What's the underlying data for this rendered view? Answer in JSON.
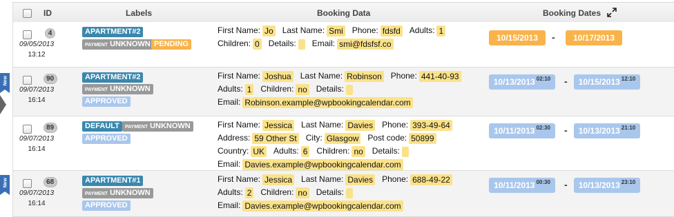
{
  "header": {
    "id": "ID",
    "labels": "Labels",
    "booking_data": "Booking Data",
    "booking_dates": "Booking Dates"
  },
  "new_flag": "New",
  "rows": [
    {
      "id": "4",
      "date": "09/05/2013",
      "time": "13:12",
      "resource": "APARTMENT#2",
      "payment_small": "PAYMENT",
      "payment": "UNKNOWN",
      "status": "PENDING",
      "lines": [
        [
          [
            "First Name:",
            "Jo"
          ],
          [
            "Last Name:",
            "Smi"
          ],
          [
            "Phone:",
            "fdsfd"
          ],
          [
            "Adults:",
            "1"
          ]
        ],
        [
          [
            "Children:",
            "0"
          ],
          [
            "Details:",
            ""
          ],
          [
            "Email:",
            "smi@fdsfsf.co"
          ]
        ]
      ],
      "dates": [
        {
          "d": "10/15/2013",
          "t": ""
        },
        {
          "d": "10/17/2013",
          "t": ""
        }
      ],
      "dash": "-"
    },
    {
      "id": "90",
      "date": "09/07/2013",
      "time": "16:14",
      "resource": "APARTMENT#2",
      "payment_small": "PAYMENT",
      "payment": "UNKNOWN",
      "status": "APPROVED",
      "lines": [
        [
          [
            "First Name:",
            "Joshua"
          ],
          [
            "Last Name:",
            "Robinson"
          ],
          [
            "Phone:",
            "441-40-93"
          ]
        ],
        [
          [
            "Adults:",
            "1"
          ],
          [
            "Children:",
            "no"
          ],
          [
            "Details:",
            ""
          ]
        ],
        [
          [
            "Email:",
            "Robinson.example@wpbookingcalendar.com"
          ]
        ]
      ],
      "dates": [
        {
          "d": "10/13/2013",
          "t": "02:10"
        },
        {
          "d": "10/15/2013",
          "t": "12:10"
        }
      ],
      "dash": "-"
    },
    {
      "id": "89",
      "date": "09/07/2013",
      "time": "16:14",
      "resource": "DEFAULT",
      "payment_small": "PAYMENT",
      "payment": "UNKNOWN",
      "status": "APPROVED",
      "lines": [
        [
          [
            "First Name:",
            "Jessica"
          ],
          [
            "Last Name:",
            "Davies"
          ],
          [
            "Phone:",
            "393-49-64"
          ]
        ],
        [
          [
            "Address:",
            "59 Other St"
          ],
          [
            "City:",
            "Glasgow"
          ],
          [
            "Post code:",
            "50899"
          ]
        ],
        [
          [
            "Country:",
            "UK"
          ],
          [
            "Adults:",
            "6"
          ],
          [
            "Children:",
            "no"
          ],
          [
            "Details:",
            ""
          ]
        ],
        [
          [
            "Email:",
            "Davies.example@wpbookingcalendar.com"
          ]
        ]
      ],
      "dates": [
        {
          "d": "10/11/2013",
          "t": "02:30"
        },
        {
          "d": "10/13/2013",
          "t": "21:10"
        }
      ],
      "dash": "-"
    },
    {
      "id": "68",
      "date": "09/07/2013",
      "time": "16:14",
      "resource": "APARTMENT#1",
      "payment_small": "PAYMENT",
      "payment": "UNKNOWN",
      "status": "APPROVED",
      "lines": [
        [
          [
            "First Name:",
            "Jessica"
          ],
          [
            "Last Name:",
            "Davies"
          ],
          [
            "Phone:",
            "688-49-22"
          ]
        ],
        [
          [
            "Adults:",
            "2"
          ],
          [
            "Children:",
            "no"
          ],
          [
            "Details:",
            ""
          ]
        ],
        [
          [
            "Email:",
            "Davies.example@wpbookingcalendar.com"
          ]
        ]
      ],
      "dates": [
        {
          "d": "10/11/2013",
          "t": "00:30"
        },
        {
          "d": "10/13/2013",
          "t": "23:10"
        }
      ],
      "dash": "-"
    }
  ],
  "colors": {
    "resource": "#3a87ad",
    "payment": "#999999",
    "pending": "#f9b34a",
    "approved": "#a9c7ec",
    "field_highlight": "#fbe28a",
    "new_flag": "#3a6fb5"
  },
  "icons": {
    "expand": "expand-arrows-icon",
    "new": "new-flag-icon",
    "pointer": "row-pointer-arrow-icon"
  }
}
